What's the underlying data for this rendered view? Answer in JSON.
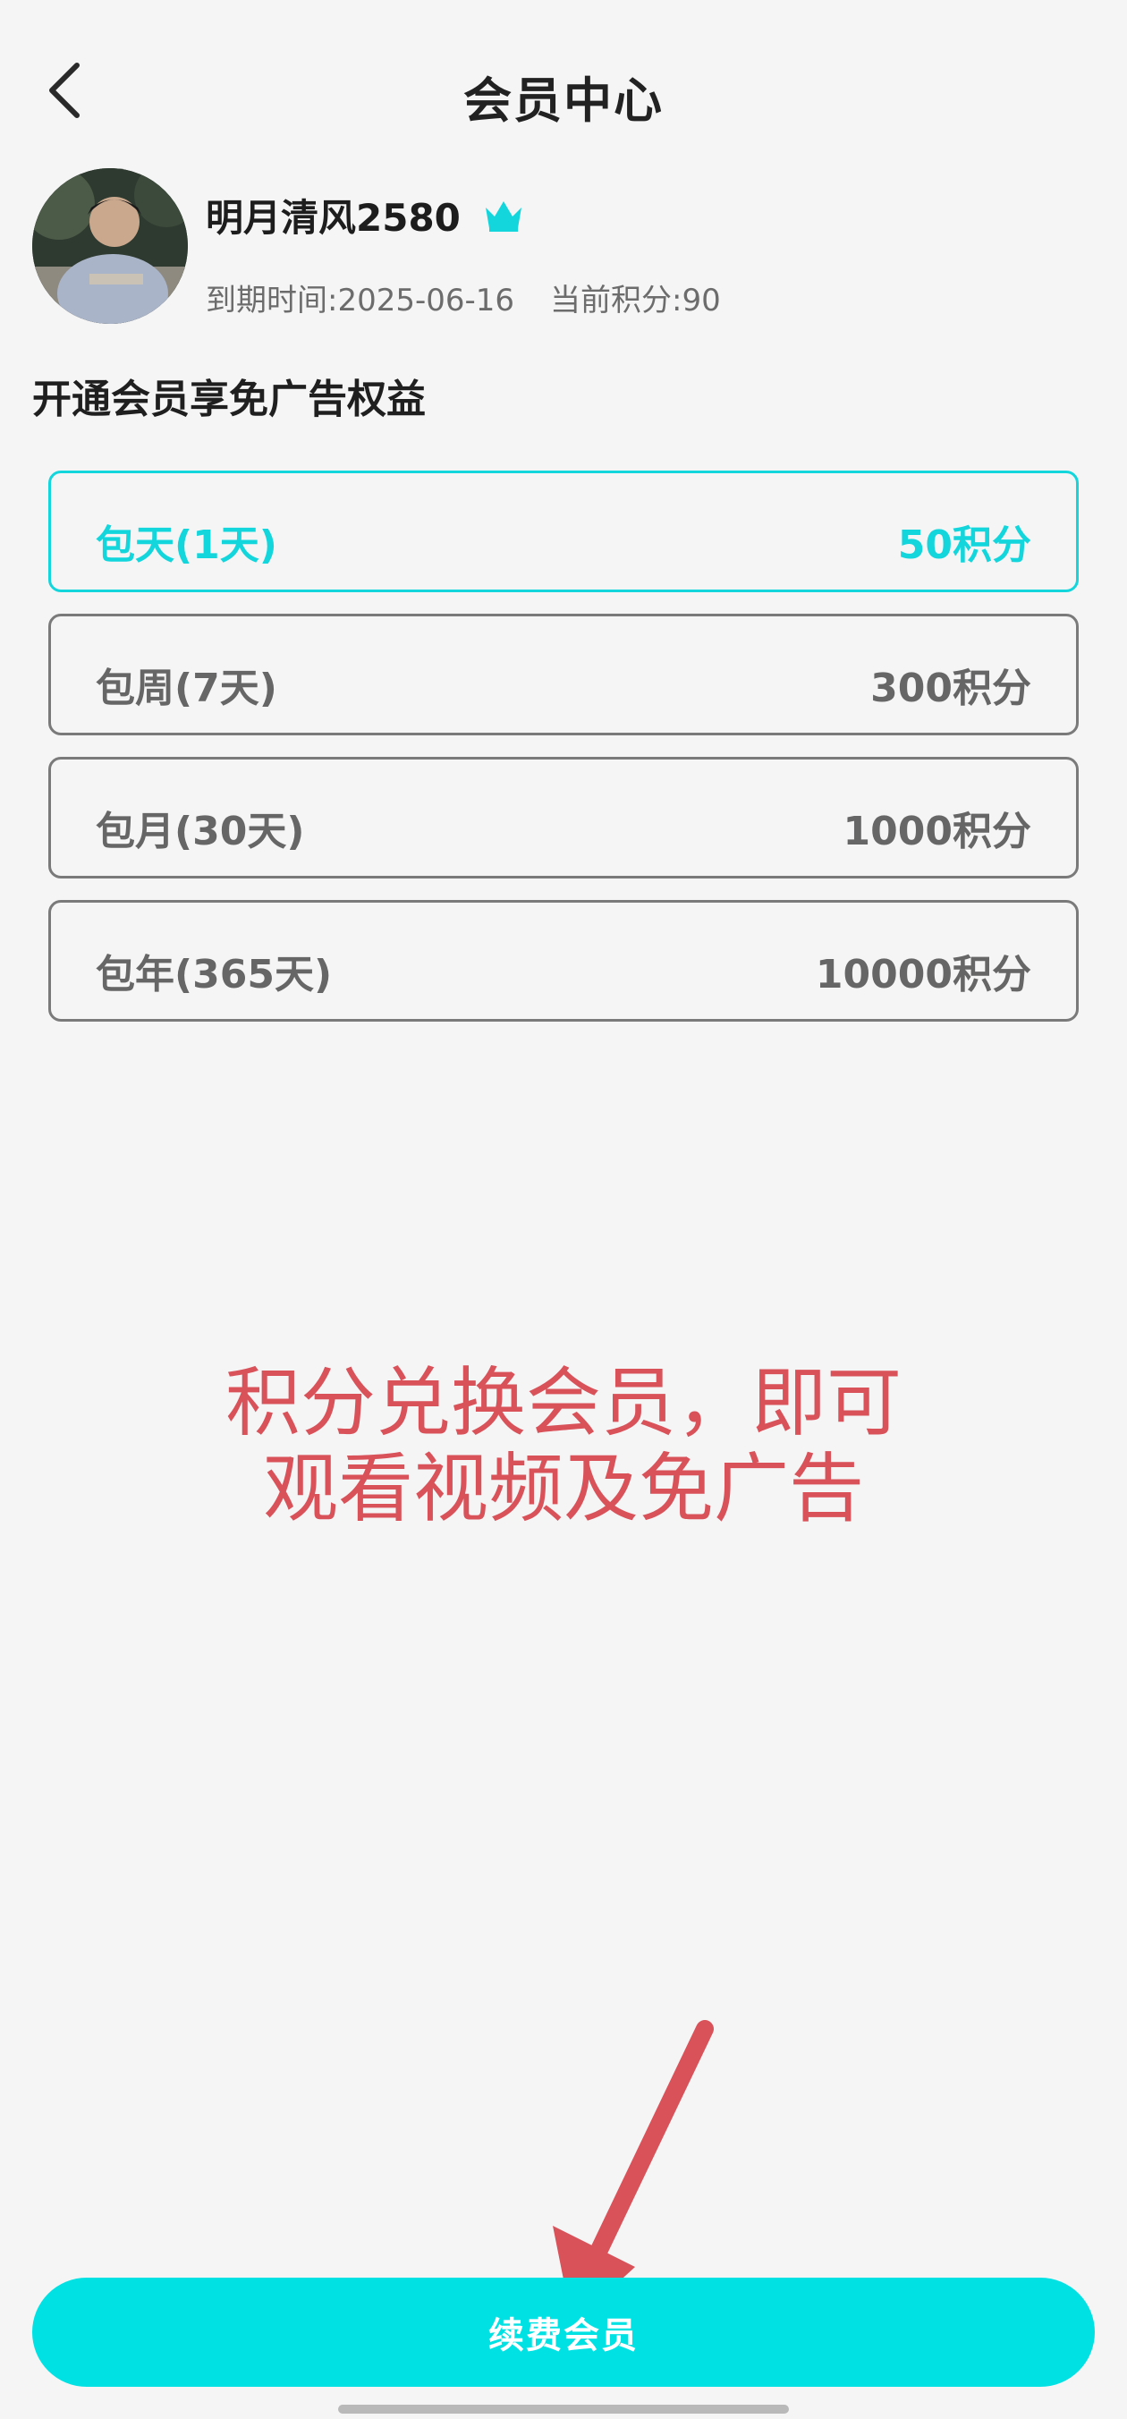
{
  "header": {
    "title": "会员中心",
    "back_icon": "chevron-left-icon"
  },
  "profile": {
    "username": "明月清风2580",
    "badge_icon": "crown-icon",
    "badge_color": "#13d6dc",
    "expiry_label": "到期时间:2025-06-16",
    "points_label": "当前积分:90"
  },
  "section_title": "开通会员享免广告权益",
  "plans": [
    {
      "name": "包天(1天)",
      "price": "50积分",
      "selected": true
    },
    {
      "name": "包周(7天)",
      "price": "300积分",
      "selected": false
    },
    {
      "name": "包月(30天)",
      "price": "1000积分",
      "selected": false
    },
    {
      "name": "包年(365天)",
      "price": "10000积分",
      "selected": false
    }
  ],
  "promo": {
    "line1": "积分兑换会员，即可",
    "line2": "观看视频及免广告",
    "color": "#d9525a"
  },
  "annotation_icon": "arrow-icon",
  "renew_button": {
    "label": "续费会员",
    "color": "#00e1e4"
  },
  "colors": {
    "accent": "#13d6dc",
    "background": "#f5f5f6"
  }
}
